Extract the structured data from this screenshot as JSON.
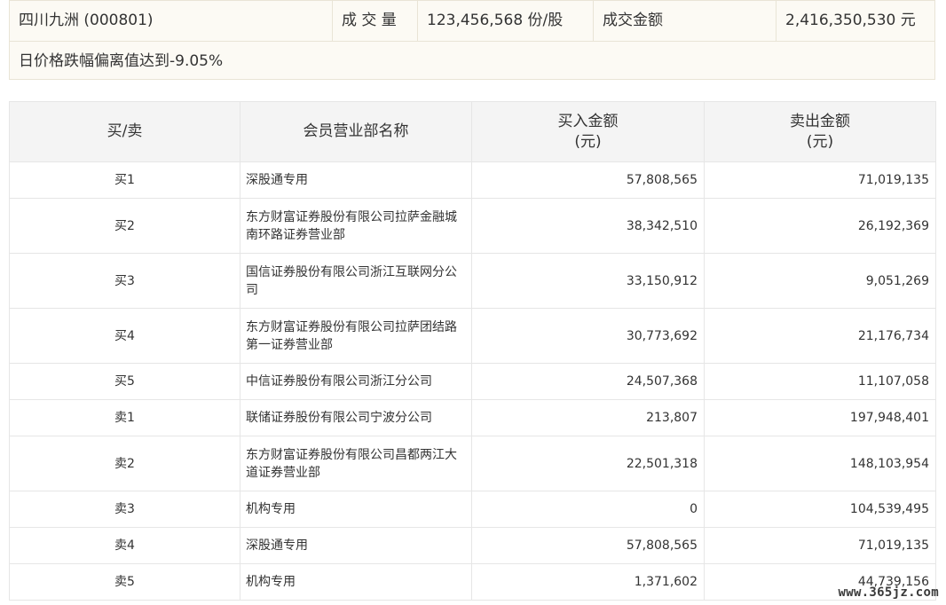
{
  "summary": {
    "stock": "四川九洲 (000801)",
    "volume_label": "成 交 量",
    "volume_value": "123,456,568 份/股",
    "amount_label": "成交金额",
    "amount_value": "2,416,350,530 元",
    "note": "日价格跌幅偏离值达到-9.05%"
  },
  "table": {
    "headers": {
      "side": "买/卖",
      "member": "会员营业部名称",
      "buy_line1": "买入金额",
      "buy_line2": "(元)",
      "sell_line1": "卖出金额",
      "sell_line2": "(元)"
    },
    "rows": [
      {
        "side": "买1",
        "name": "深股通专用",
        "buy": "57,808,565",
        "sell": "71,019,135"
      },
      {
        "side": "买2",
        "name": "东方财富证券股份有限公司拉萨金融城南环路证券营业部",
        "buy": "38,342,510",
        "sell": "26,192,369"
      },
      {
        "side": "买3",
        "name": "国信证券股份有限公司浙江互联网分公司",
        "buy": "33,150,912",
        "sell": "9,051,269"
      },
      {
        "side": "买4",
        "name": "东方财富证券股份有限公司拉萨团结路第一证券营业部",
        "buy": "30,773,692",
        "sell": "21,176,734"
      },
      {
        "side": "买5",
        "name": "中信证券股份有限公司浙江分公司",
        "buy": "24,507,368",
        "sell": "11,107,058"
      },
      {
        "side": "卖1",
        "name": "联储证券股份有限公司宁波分公司",
        "buy": "213,807",
        "sell": "197,948,401"
      },
      {
        "side": "卖2",
        "name": "东方财富证券股份有限公司昌都两江大道证券营业部",
        "buy": "22,501,318",
        "sell": "148,103,954"
      },
      {
        "side": "卖3",
        "name": "机构专用",
        "buy": "0",
        "sell": "104,539,495"
      },
      {
        "side": "卖4",
        "name": "深股通专用",
        "buy": "57,808,565",
        "sell": "71,019,135"
      },
      {
        "side": "卖5",
        "name": "机构专用",
        "buy": "1,371,602",
        "sell": "44,739,156"
      }
    ]
  },
  "watermark": "www.365jz.com"
}
